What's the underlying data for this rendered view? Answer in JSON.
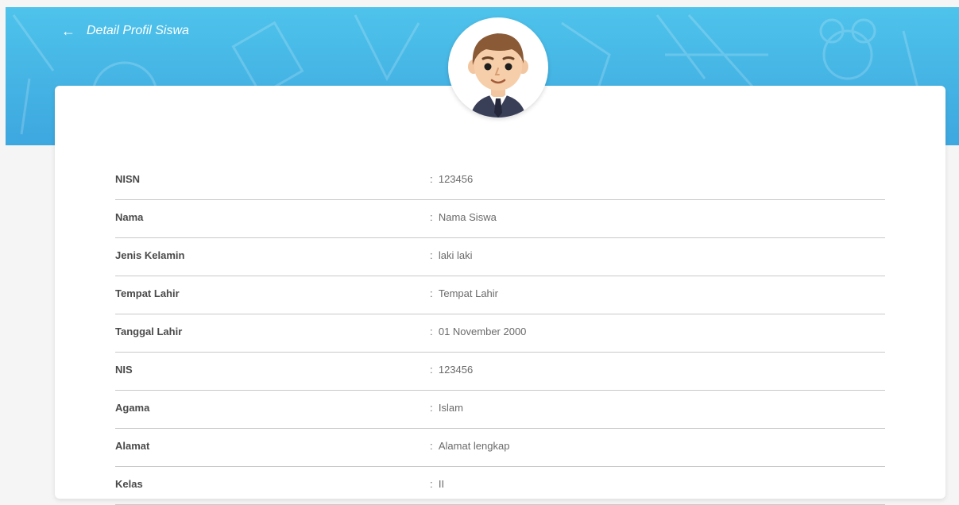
{
  "header": {
    "back_icon": "arrow-left-icon",
    "title": "Detail Profil Siswa"
  },
  "profile": {
    "avatar_icon": "male-student-avatar",
    "fields": [
      {
        "label": "NISN",
        "value": "123456"
      },
      {
        "label": "Nama",
        "value": "Nama Siswa"
      },
      {
        "label": "Jenis Kelamin",
        "value": "laki laki"
      },
      {
        "label": "Tempat Lahir",
        "value": "Tempat Lahir"
      },
      {
        "label": "Tanggal Lahir",
        "value": "01 November 2000"
      },
      {
        "label": "NIS",
        "value": "123456"
      },
      {
        "label": "Agama",
        "value": "Islam"
      },
      {
        "label": "Alamat",
        "value": "Alamat lengkap"
      },
      {
        "label": "Kelas",
        "value": "II"
      }
    ]
  },
  "colors": {
    "header_top": "#4ec3eb",
    "header_bottom": "#3da7df",
    "background": "#f5f5f5",
    "card": "#ffffff"
  }
}
